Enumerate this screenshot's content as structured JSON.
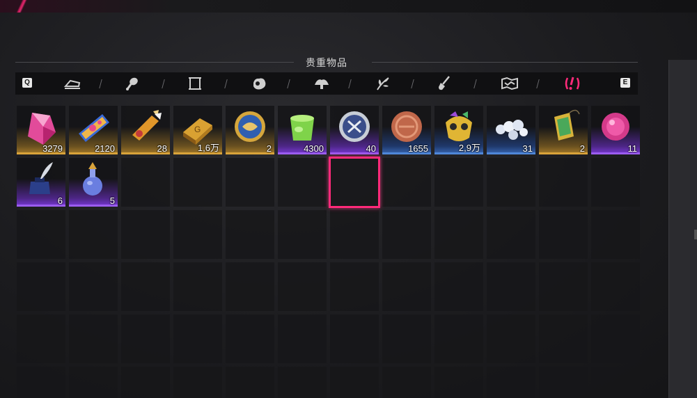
{
  "title": "贵重物品",
  "keys": {
    "left": "Q",
    "right": "E"
  },
  "colors": {
    "accent": "#ff2a7a",
    "gold": "#d9a33a",
    "purple": "#9b5cf0",
    "blue": "#4f87d8"
  },
  "tabs": [
    {
      "id": "tab-consumables",
      "icon": "bed-icon",
      "active": false
    },
    {
      "id": "tab-ingredients",
      "icon": "drumstick-icon",
      "active": false
    },
    {
      "id": "tab-scrolls",
      "icon": "scroll-icon",
      "active": false
    },
    {
      "id": "tab-materials",
      "icon": "ore-icon",
      "active": false
    },
    {
      "id": "tab-gatherables",
      "icon": "mushroom-icon",
      "active": false
    },
    {
      "id": "tab-plants",
      "icon": "leaf-icon",
      "active": false
    },
    {
      "id": "tab-tools",
      "icon": "shovel-icon",
      "active": false
    },
    {
      "id": "tab-maps",
      "icon": "map-icon",
      "active": false
    },
    {
      "id": "tab-valuables",
      "icon": "valuable-exclaim-icon",
      "active": true
    }
  ],
  "items": [
    {
      "name": "pink-crystal",
      "tier": "gold",
      "qty": "3279"
    },
    {
      "name": "parade-float-ticket",
      "tier": "gold",
      "qty": "2120"
    },
    {
      "name": "fish-tag",
      "tier": "gold",
      "qty": "28"
    },
    {
      "name": "gold-bar",
      "tier": "gold",
      "qty": "1,6万"
    },
    {
      "name": "engraved-gold-coin",
      "tier": "gold",
      "qty": "2"
    },
    {
      "name": "green-jelly-cup",
      "tier": "purple",
      "qty": "4300"
    },
    {
      "name": "silver-emblem-coin",
      "tier": "purple",
      "qty": "40"
    },
    {
      "name": "bronze-coin",
      "tier": "blue",
      "qty": "1655"
    },
    {
      "name": "jeweled-mask",
      "tier": "blue",
      "qty": "2,9万"
    },
    {
      "name": "pearls",
      "tier": "blue",
      "qty": "31"
    },
    {
      "name": "gold-card-pendant",
      "tier": "gold",
      "qty": "2"
    },
    {
      "name": "pink-orb",
      "tier": "purple",
      "qty": "11"
    },
    {
      "name": "ink-and-quill",
      "tier": "purple",
      "qty": "6"
    },
    {
      "name": "potion-flask",
      "tier": "purple",
      "qty": "5"
    }
  ]
}
